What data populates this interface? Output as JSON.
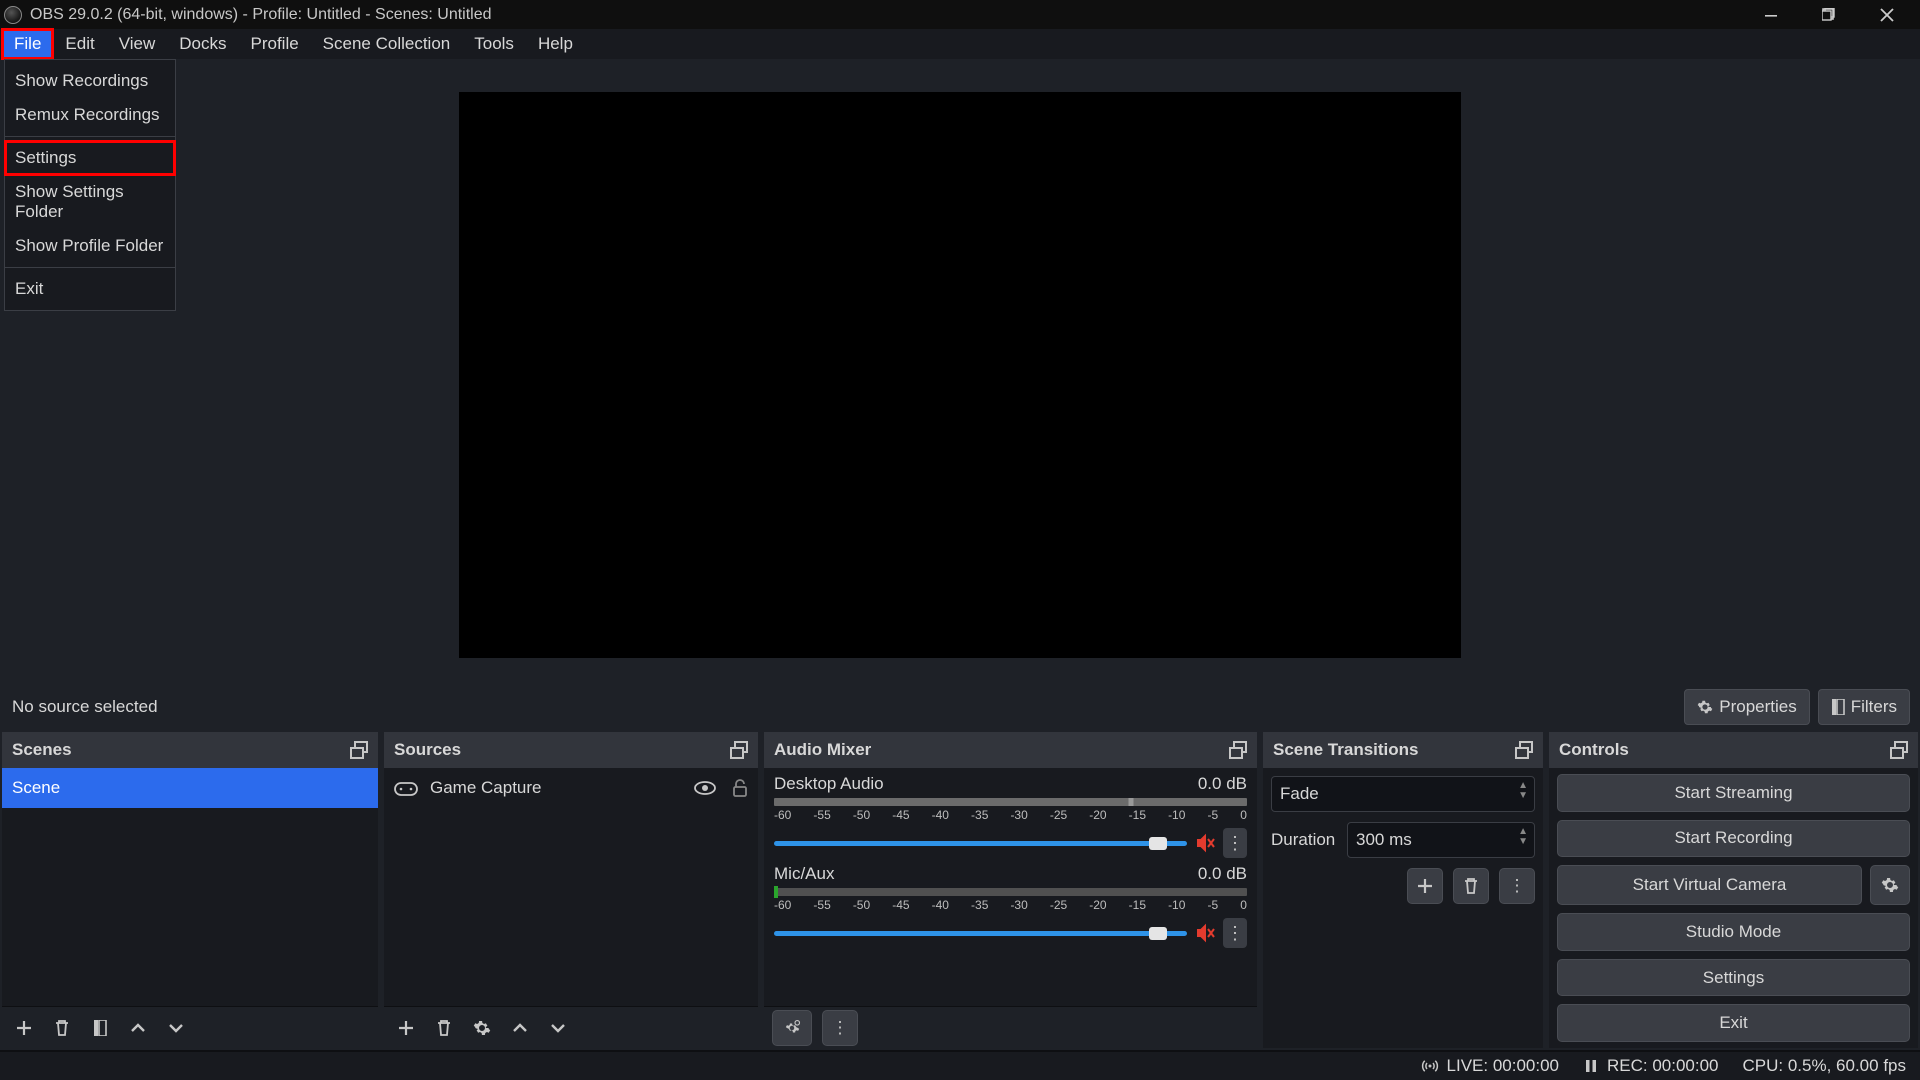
{
  "titlebar": {
    "text": "OBS 29.0.2 (64-bit, windows) - Profile: Untitled - Scenes: Untitled"
  },
  "menu": {
    "items": [
      "File",
      "Edit",
      "View",
      "Docks",
      "Profile",
      "Scene Collection",
      "Tools",
      "Help"
    ]
  },
  "file_menu": {
    "show_recordings": "Show Recordings",
    "remux": "Remux Recordings",
    "settings": "Settings",
    "show_settings_folder": "Show Settings Folder",
    "show_profile_folder": "Show Profile Folder",
    "exit": "Exit"
  },
  "source_bar": {
    "no_source": "No source selected",
    "properties": "Properties",
    "filters": "Filters"
  },
  "docks": {
    "scenes": {
      "title": "Scenes",
      "items": [
        "Scene"
      ]
    },
    "sources": {
      "title": "Sources",
      "items": [
        "Game Capture"
      ]
    },
    "audio": {
      "title": "Audio Mixer",
      "channels": [
        {
          "name": "Desktop Audio",
          "db": "0.0 dB"
        },
        {
          "name": "Mic/Aux",
          "db": "0.0 dB"
        }
      ],
      "ticks": [
        "-60",
        "-55",
        "-50",
        "-45",
        "-40",
        "-35",
        "-30",
        "-25",
        "-20",
        "-15",
        "-10",
        "-5",
        "0"
      ]
    },
    "transitions": {
      "title": "Scene Transitions",
      "current": "Fade",
      "duration_label": "Duration",
      "duration_value": "300 ms"
    },
    "controls": {
      "title": "Controls",
      "start_streaming": "Start Streaming",
      "start_recording": "Start Recording",
      "start_vcam": "Start Virtual Camera",
      "studio": "Studio Mode",
      "settings": "Settings",
      "exit": "Exit"
    }
  },
  "status": {
    "live": "LIVE: 00:00:00",
    "rec": "REC: 00:00:00",
    "cpu": "CPU: 0.5%, 60.00 fps"
  }
}
